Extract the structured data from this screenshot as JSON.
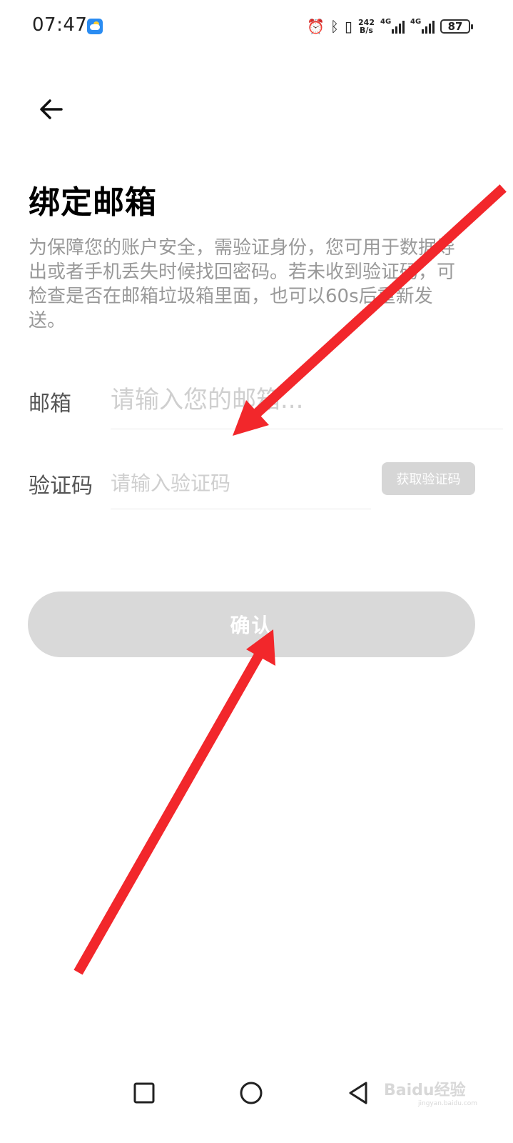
{
  "status_bar": {
    "time": "07:47",
    "net_speed_value": "242",
    "net_speed_unit": "B/s",
    "sim1": "4G",
    "sim2": "4G",
    "battery": "87"
  },
  "header": {
    "title": "绑定邮箱"
  },
  "description": "为保障您的账户安全，需验证身份，您可用于数据导出或者手机丢失时候找回密码。若未收到验证码，可检查是否在邮箱垃圾箱里面，也可以60s后重新发送。",
  "form": {
    "email_label": "邮箱",
    "email_placeholder": "请输入您的邮箱...",
    "code_label": "验证码",
    "code_placeholder": "请输入验证码",
    "get_code_label": "获取验证码",
    "confirm_label": "确认"
  },
  "watermark": {
    "brand": "Baidu经验",
    "url": "jingyan.baidu.com"
  },
  "colors": {
    "annotation_arrow": "#f2272b",
    "disabled_button": "#d9d9d9",
    "placeholder": "#cfcfcf",
    "description": "#999999"
  }
}
